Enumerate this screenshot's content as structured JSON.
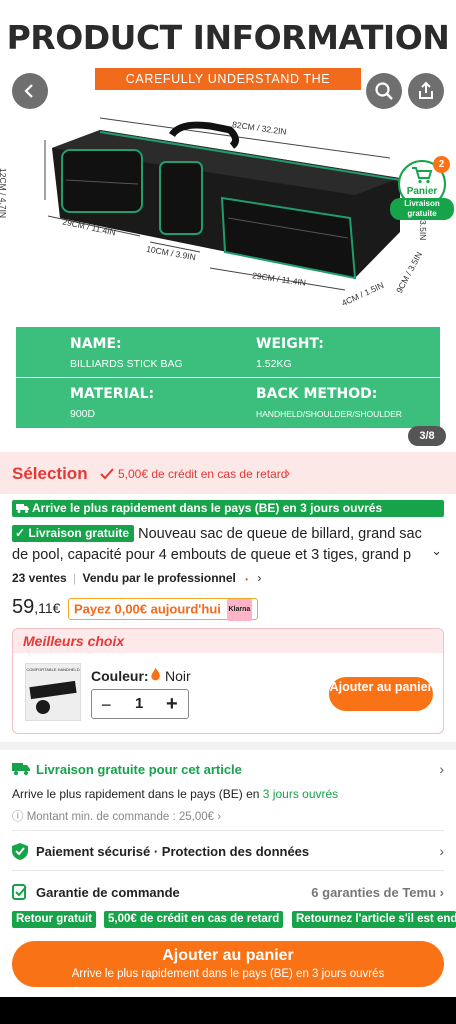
{
  "hero": {
    "title": "PRODUCT INFORMATION",
    "subtitle": "CAREFULLY UNDERSTAND THE PRODUCT",
    "dims": {
      "length": "82CM / 32.2IN",
      "height": "12CM / 4.7IN",
      "pocket_w": "29CM / 11.4IN",
      "pocket_gap": "10CM / 3.9IN",
      "pocket_w2": "29CM / 11.4IN",
      "depth": "4CM / 1.5IN",
      "end": "9CM / 3.5IN",
      "side": "3.5IN"
    },
    "specs": {
      "name_label": "NAME:",
      "name_value": "BILLIARDS STICK BAG",
      "weight_label": "WEIGHT:",
      "weight_value": "1.52KG",
      "material_label": "MATERIAL:",
      "material_value": "900D",
      "back_label": "BACK METHOD:",
      "back_value": "HANDHELD/SHOULDER/SHOULDER"
    },
    "pager": "3/8",
    "cart": {
      "count": "2",
      "label": "Panier",
      "sub": "Livraison gratuite"
    }
  },
  "selection": {
    "title": "Sélection",
    "credit": "5,00€ de crédit en cas de retard"
  },
  "arrival_bar": "Arrive le plus rapidement dans le pays (BE) en 3 jours ouvrés",
  "free_badge": "Livraison gratuite",
  "product_title": "Nouveau sac de queue de billard, grand sac de pool, capacité pour 4 embouts de queue et 3 tiges, grand p",
  "sales": "23 ventes",
  "seller": "Vendu par le professionnel",
  "price": {
    "int": "59",
    "dec": ",11€"
  },
  "klarna": {
    "text": "Payez 0,00€ aujourd'hui",
    "brand": "Klarna"
  },
  "best": {
    "header": "Meilleurs choix",
    "thumb_label": "COMFORTABLE HANDHELD",
    "color_label": "Couleur:",
    "color_value": "Noir",
    "qty": "1",
    "add_label": "Ajouter au panier"
  },
  "shipping": {
    "title": "Livraison gratuite pour cet article",
    "line_pre": "Arrive le plus rapidement dans le pays (BE) en",
    "line_hl": "3 jours ouvrés",
    "minimum": "Montant min. de commande : 25,00€"
  },
  "security": {
    "pay": "Paiement sécurisé",
    "sep": "·",
    "privacy": "Protection des données"
  },
  "guarantee": {
    "title": "Garantie de commande",
    "link": "6 garanties de Temu",
    "tags": [
      "Retour gratuit",
      "5,00€ de crédit en cas de retard",
      "Retournez l'article s'il est endommagé"
    ]
  },
  "bottom": {
    "label": "Ajouter au panier",
    "sub": "Arrive le plus rapidement dans le pays (BE) en 3 jours ouvrés"
  },
  "colors": {
    "accent": "#f97316",
    "green": "#16a34a",
    "red": "#e53935",
    "spec_green": "#3cbf7d"
  }
}
